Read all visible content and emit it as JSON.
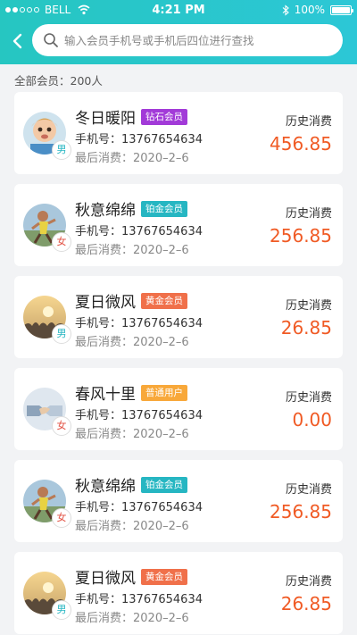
{
  "status_bar": {
    "carrier": "BELL",
    "time": "4:21 PM",
    "battery": "100%"
  },
  "search": {
    "placeholder": "输入会员手机号或手机后四位进行查找"
  },
  "summary": {
    "text": "全部会员：200人"
  },
  "colors": {
    "header_gradient_start": "#26c6c1",
    "header_gradient_end": "#2cc7d6",
    "amount": "#f05a24",
    "badge_diamond": "#a23ad8",
    "badge_platinum": "#26b6c2",
    "badge_gold": "#f0704a",
    "badge_regular": "#f8a83a"
  },
  "members": [
    {
      "name": "冬日暖阳",
      "level": "钻石会员",
      "level_color": "#a23ad8",
      "gender": "男",
      "phone_label": "手机号：",
      "phone": "13767654634",
      "last_label": "最后消费：",
      "last_date": "2020–2–6",
      "history_label": "历史消费",
      "amount": "456.85",
      "avatar": "child"
    },
    {
      "name": "秋意绵绵",
      "level": "铂金会员",
      "level_color": "#26b6c2",
      "gender": "女",
      "phone_label": "手机号：",
      "phone": "13767654634",
      "last_label": "最后消费：",
      "last_date": "2020–2–6",
      "history_label": "历史消费",
      "amount": "256.85",
      "avatar": "runner"
    },
    {
      "name": "夏日微风",
      "level": "黄金会员",
      "level_color": "#f0704a",
      "gender": "男",
      "phone_label": "手机号：",
      "phone": "13767654634",
      "last_label": "最后消费：",
      "last_date": "2020–2–6",
      "history_label": "历史消费",
      "amount": "26.85",
      "avatar": "sunset"
    },
    {
      "name": "春风十里",
      "level": "普通用户",
      "level_color": "#f8a83a",
      "gender": "女",
      "phone_label": "手机号：",
      "phone": "13767654634",
      "last_label": "最后消费：",
      "last_date": "2020–2–6",
      "history_label": "历史消费",
      "amount": "0.00",
      "avatar": "handshake"
    },
    {
      "name": "秋意绵绵",
      "level": "铂金会员",
      "level_color": "#26b6c2",
      "gender": "女",
      "phone_label": "手机号：",
      "phone": "13767654634",
      "last_label": "最后消费：",
      "last_date": "2020–2–6",
      "history_label": "历史消费",
      "amount": "256.85",
      "avatar": "runner"
    },
    {
      "name": "夏日微风",
      "level": "黄金会员",
      "level_color": "#f0704a",
      "gender": "男",
      "phone_label": "手机号：",
      "phone": "13767654634",
      "last_label": "最后消费：",
      "last_date": "2020–2–6",
      "history_label": "历史消费",
      "amount": "26.85",
      "avatar": "sunset"
    }
  ]
}
